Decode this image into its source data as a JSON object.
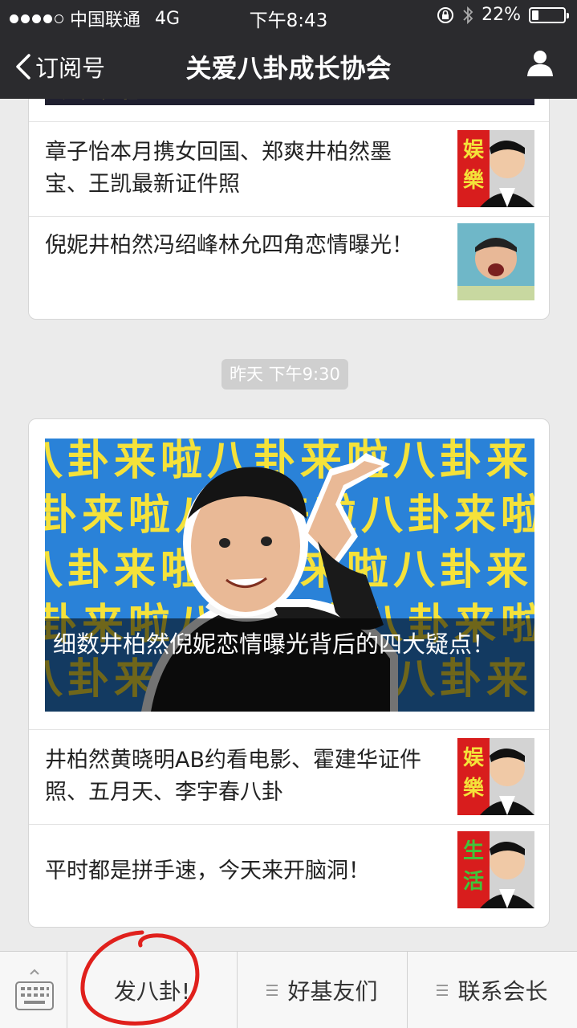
{
  "status_bar": {
    "carrier": "中国联通",
    "network": "4G",
    "time": "下午8:43",
    "battery": "22%",
    "battery_level": 0.22
  },
  "nav": {
    "back_label": "订阅号",
    "title": "关爱八卦成长协会"
  },
  "card1": {
    "articles": [
      {
        "title": "章子怡本月携女回国、郑爽井柏然墨宝、王凯最新证件照",
        "thumb_badge": "娱樂"
      },
      {
        "title": "倪妮井柏然冯绍峰林允四角恋情曝光！",
        "thumb_badge": ""
      }
    ]
  },
  "timestamp": "昨天 下午9:30",
  "card2": {
    "cover": {
      "caption": "细数井柏然倪妮恋情曝光背后的四大疑点！",
      "background_text": "八卦来啦"
    },
    "articles": [
      {
        "title": "井柏然黄晓明AB约看电影、霍建华证件照、五月天、李宇春八卦",
        "thumb_badge": "娱樂"
      },
      {
        "title": "平时都是拼手速，今天来开脑洞！",
        "thumb_badge": "生活"
      }
    ]
  },
  "bottom_menu": {
    "items": [
      "发八卦!",
      "好基友们",
      "联系会长"
    ]
  },
  "colors": {
    "nav_bg": "#2b2b2e",
    "page_bg": "#ebebeb",
    "scribble": "#e0201c",
    "cover_bg": "#2a82d8",
    "cover_text": "#f5e23a"
  }
}
